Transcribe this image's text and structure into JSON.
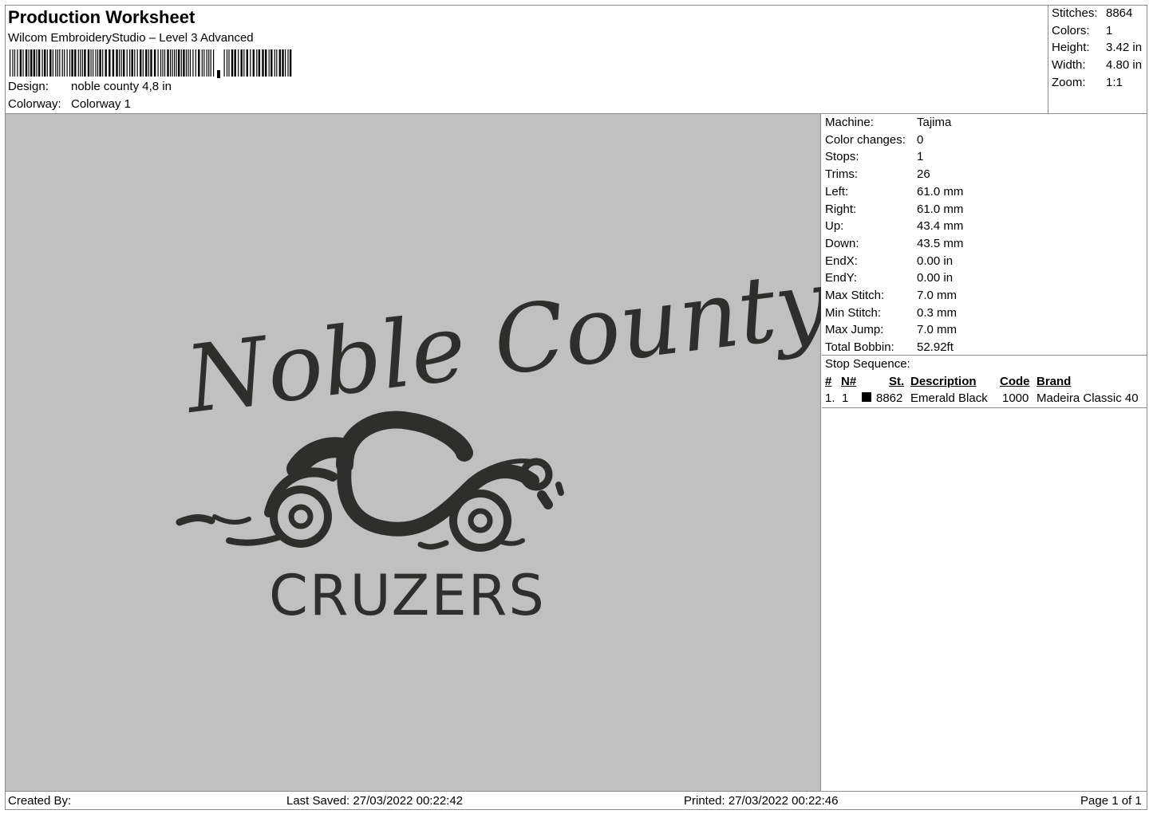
{
  "header": {
    "title": "Production Worksheet",
    "subtitle": "Wilcom EmbroideryStudio – Level 3 Advanced",
    "design_label": "Design:",
    "design_value": "noble county 4,8 in",
    "colorway_label": "Colorway:",
    "colorway_value": "Colorway 1"
  },
  "summary": {
    "stitches_label": "Stitches:",
    "stitches": "8864",
    "colors_label": "Colors:",
    "colors": "1",
    "height_label": "Height:",
    "height": "3.42 in",
    "width_label": "Width:",
    "width": "4.80 in",
    "zoom_label": "Zoom:",
    "zoom": "1:1"
  },
  "design": {
    "line1": "Noble County",
    "line2": "CRUZERS",
    "thread_color": "#2e2e2c",
    "background": "#c0c0c0"
  },
  "machine": {
    "rows": [
      {
        "k": "Machine:",
        "v": "Tajima"
      },
      {
        "k": "Color changes:",
        "v": "0"
      },
      {
        "k": "Stops:",
        "v": "1"
      },
      {
        "k": "Trims:",
        "v": "26"
      },
      {
        "k": "Left:",
        "v": "61.0 mm"
      },
      {
        "k": "Right:",
        "v": "61.0 mm"
      },
      {
        "k": "Up:",
        "v": "43.4 mm"
      },
      {
        "k": "Down:",
        "v": "43.5 mm"
      },
      {
        "k": "EndX:",
        "v": "0.00 in"
      },
      {
        "k": "EndY:",
        "v": "0.00 in"
      },
      {
        "k": "Max Stitch:",
        "v": "7.0 mm"
      },
      {
        "k": "Min Stitch:",
        "v": "0.3 mm"
      },
      {
        "k": "Max Jump:",
        "v": "7.0 mm"
      },
      {
        "k": "Total Bobbin:",
        "v": "52.92ft"
      }
    ]
  },
  "stop_sequence": {
    "label": "Stop Sequence:",
    "headers": {
      "num": "#",
      "n": "N#",
      "st": "St.",
      "desc": "Description",
      "code": "Code",
      "brand": "Brand"
    },
    "rows": [
      {
        "num": "1.",
        "n": "1",
        "swatch": "#000000",
        "st": "8862",
        "desc": "Emerald Black",
        "code": "1000",
        "brand": "Madeira Classic 40"
      }
    ]
  },
  "footer": {
    "created_by": "Created By:",
    "last_saved": "Last Saved: 27/03/2022 00:22:42",
    "printed": "Printed: 27/03/2022 00:22:46",
    "page": "Page 1 of 1"
  }
}
